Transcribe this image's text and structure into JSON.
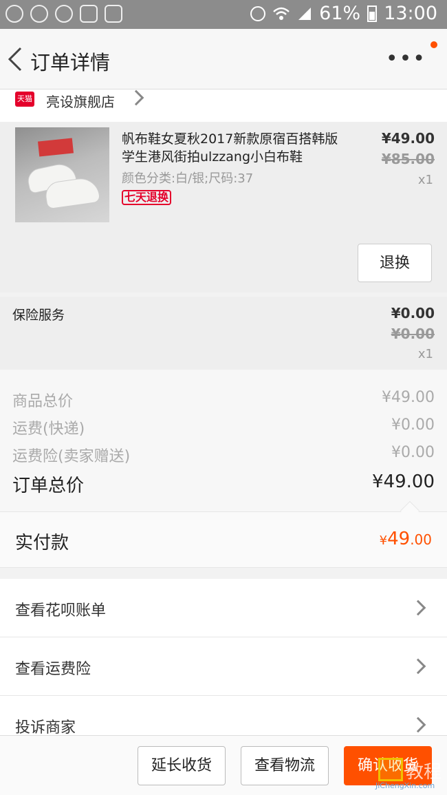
{
  "status_bar": {
    "battery": "61%",
    "time": "13:00"
  },
  "header": {
    "title": "订单详情",
    "more": "•••"
  },
  "shop": {
    "badge": "天猫",
    "name": "亮设旗舰店"
  },
  "product": {
    "name": "帆布鞋女夏秋2017新款原宿百搭韩版学生港风街拍ulzzang小白布鞋",
    "sku": "颜色分类:白/银;尺码:37",
    "tag": "七天退换",
    "price": "¥49.00",
    "original_price": "¥85.00",
    "qty": "x1",
    "return_button": "退换"
  },
  "insurance": {
    "name": "保险服务",
    "price": "¥0.00",
    "original_price": "¥0.00",
    "qty": "x1"
  },
  "totals": {
    "goods_label": "商品总价",
    "goods_value": "¥49.00",
    "shipping_label": "运费(快递)",
    "shipping_value": "¥0.00",
    "shipping_ins_label": "运费险(卖家赠送)",
    "shipping_ins_value": "¥0.00",
    "order_total_label": "订单总价",
    "order_total_value": "¥49.00"
  },
  "paid": {
    "label": "实付款",
    "currency": "¥",
    "integer": "49",
    "decimal": ".00"
  },
  "list": [
    {
      "label": "查看花呗账单"
    },
    {
      "label": "查看运费险"
    },
    {
      "label": "投诉商家"
    }
  ],
  "bottom": {
    "extend": "延长收货",
    "logistics": "查看物流",
    "confirm": "确认收货"
  },
  "watermark": {
    "text": "教程",
    "sub": "JiChengXin.com"
  },
  "colors": {
    "accent": "#ff5000",
    "tmall_red": "#e4002b"
  }
}
